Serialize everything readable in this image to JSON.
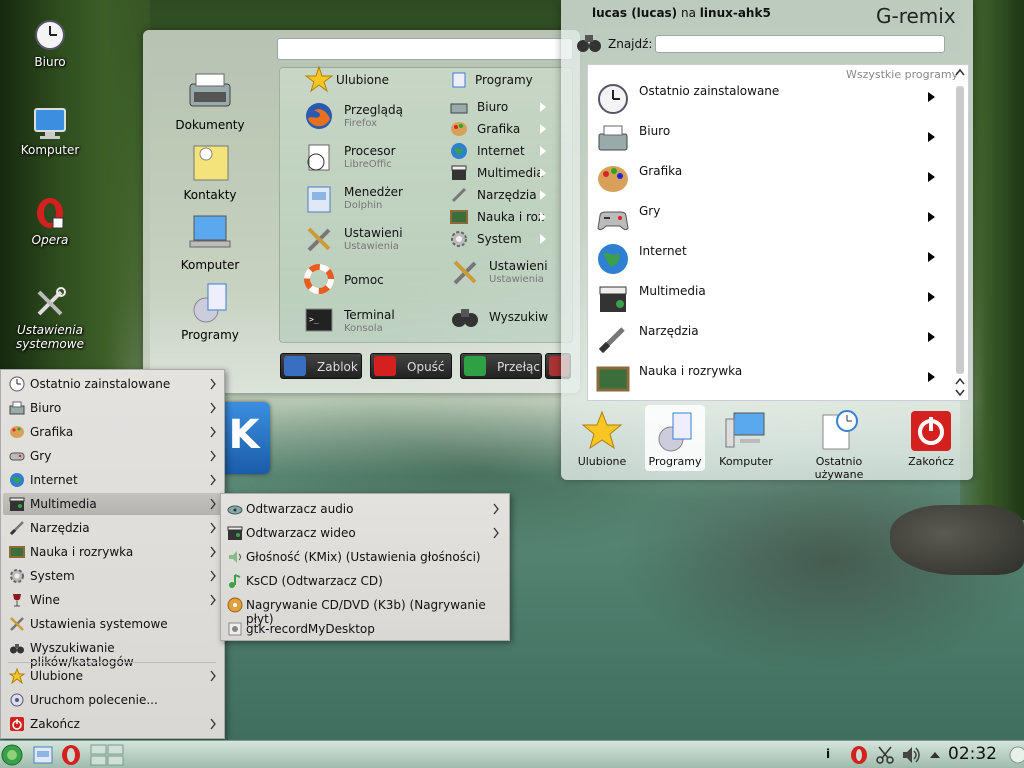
{
  "desktop_icons": [
    {
      "label": "Biuro",
      "icon": "clock-icon"
    },
    {
      "label": "Komputer",
      "icon": "monitor-icon"
    },
    {
      "label": "Opera",
      "icon": "opera-icon"
    },
    {
      "label": "Ustawienia systemowe",
      "icon": "settings-tools-icon"
    }
  ],
  "panel_left": {
    "categories": [
      "Dokumenty",
      "Kontakty",
      "Komputer",
      "Programy"
    ],
    "left_items": [
      {
        "label": "Ulubione",
        "sub": ""
      },
      {
        "label": "Przeglądą",
        "sub": "Firefox"
      },
      {
        "label": "Procesor",
        "sub": "LibreOffic"
      },
      {
        "label": "Menedżer",
        "sub": "Dolphin"
      },
      {
        "label": "Ustawieni",
        "sub": "Ustawienia"
      },
      {
        "label": "Pomoc",
        "sub": ""
      },
      {
        "label": "Terminal",
        "sub": "Konsola"
      }
    ],
    "right_items": [
      {
        "label": "Programy"
      },
      {
        "label": "Biuro"
      },
      {
        "label": "Grafika"
      },
      {
        "label": "Internet"
      },
      {
        "label": "Multimedia"
      },
      {
        "label": "Narzędzia"
      },
      {
        "label": "Nauka i roz"
      },
      {
        "label": "System"
      }
    ],
    "right_big": [
      {
        "label": "Ustawieni",
        "sub": "Ustawienia"
      },
      {
        "label": "Wyszukiw",
        "sub": ""
      }
    ],
    "buttons": {
      "lock": "Zablok",
      "logout": "Opuść",
      "switch": "Przełąc"
    }
  },
  "panel_right": {
    "user": "lucas (lucas)",
    "on": "na",
    "host": "linux-ahk5",
    "title": "G-remix",
    "find_label": "Znajdź:",
    "all_programs": "Wszystkie programy",
    "rows": [
      {
        "label": "Ostatnio zainstalowane",
        "icon": "clock-icon"
      },
      {
        "label": "Biuro",
        "icon": "typewriter-icon"
      },
      {
        "label": "Grafika",
        "icon": "palette-icon"
      },
      {
        "label": "Gry",
        "icon": "gamepad-icon"
      },
      {
        "label": "Internet",
        "icon": "globe-icon"
      },
      {
        "label": "Multimedia",
        "icon": "clapperboard-icon"
      },
      {
        "label": "Narzędzia",
        "icon": "screwdriver-icon"
      },
      {
        "label": "Nauka i rozrywka",
        "icon": "chalkboard-icon"
      }
    ],
    "bottom": [
      {
        "label": "Ulubione",
        "icon": "star-icon"
      },
      {
        "label": "Programy",
        "icon": "programs-icon"
      },
      {
        "label": "Komputer",
        "icon": "computer-icon"
      },
      {
        "label": "Ostatnio używane",
        "icon": "recent-doc-icon"
      },
      {
        "label": "Zakończ",
        "icon": "power-icon"
      }
    ]
  },
  "kde_menu": {
    "items": [
      {
        "label": "Ostatnio zainstalowane",
        "icon": "clock-icon",
        "has_sub": true
      },
      {
        "label": "Biuro",
        "icon": "typewriter-icon",
        "has_sub": true
      },
      {
        "label": "Grafika",
        "icon": "palette-icon",
        "has_sub": true
      },
      {
        "label": "Gry",
        "icon": "gamepad-icon",
        "has_sub": true
      },
      {
        "label": "Internet",
        "icon": "globe-icon",
        "has_sub": true
      },
      {
        "label": "Multimedia",
        "icon": "clapperboard-icon",
        "has_sub": true
      },
      {
        "label": "Narzędzia",
        "icon": "screwdriver-icon",
        "has_sub": true
      },
      {
        "label": "Nauka i rozrywka",
        "icon": "chalkboard-icon",
        "has_sub": true
      },
      {
        "label": "System",
        "icon": "gear-icon",
        "has_sub": true
      },
      {
        "label": "Wine",
        "icon": "wine-icon",
        "has_sub": true
      },
      {
        "label": "Ustawienia systemowe",
        "icon": "settings-tools-icon",
        "has_sub": false
      },
      {
        "label": "Wyszukiwanie plików/katalogów",
        "icon": "binoculars-icon",
        "has_sub": false
      },
      {
        "label": "Ulubione",
        "icon": "star-icon",
        "has_sub": true
      },
      {
        "label": "Uruchom polecenie...",
        "icon": "run-icon",
        "has_sub": false
      },
      {
        "label": "Zakończ",
        "icon": "power-icon",
        "has_sub": true
      }
    ],
    "submenu": [
      {
        "label": "Odtwarzacz audio",
        "icon": "audio-icon",
        "has_sub": true
      },
      {
        "label": "Odtwarzacz wideo",
        "icon": "video-icon",
        "has_sub": true
      },
      {
        "label": "Głośność (KMix) (Ustawienia głośności)",
        "icon": "speaker-icon",
        "has_sub": false
      },
      {
        "label": "KsCD (Odtwarzacz CD)",
        "icon": "music-note-icon",
        "has_sub": false
      },
      {
        "label": "Nagrywanie CD/DVD (K3b) (Nagrywanie płyt)",
        "icon": "disc-burn-icon",
        "has_sub": false
      },
      {
        "label": "gtk-recordMyDesktop",
        "icon": "record-icon",
        "has_sub": false
      }
    ]
  },
  "taskbar": {
    "clock": "02:32",
    "info": "i"
  },
  "colors": {
    "accent_red": "#d4201f",
    "kde_blue": "#2f7fd3",
    "menu_bg": "#dddcd9"
  }
}
